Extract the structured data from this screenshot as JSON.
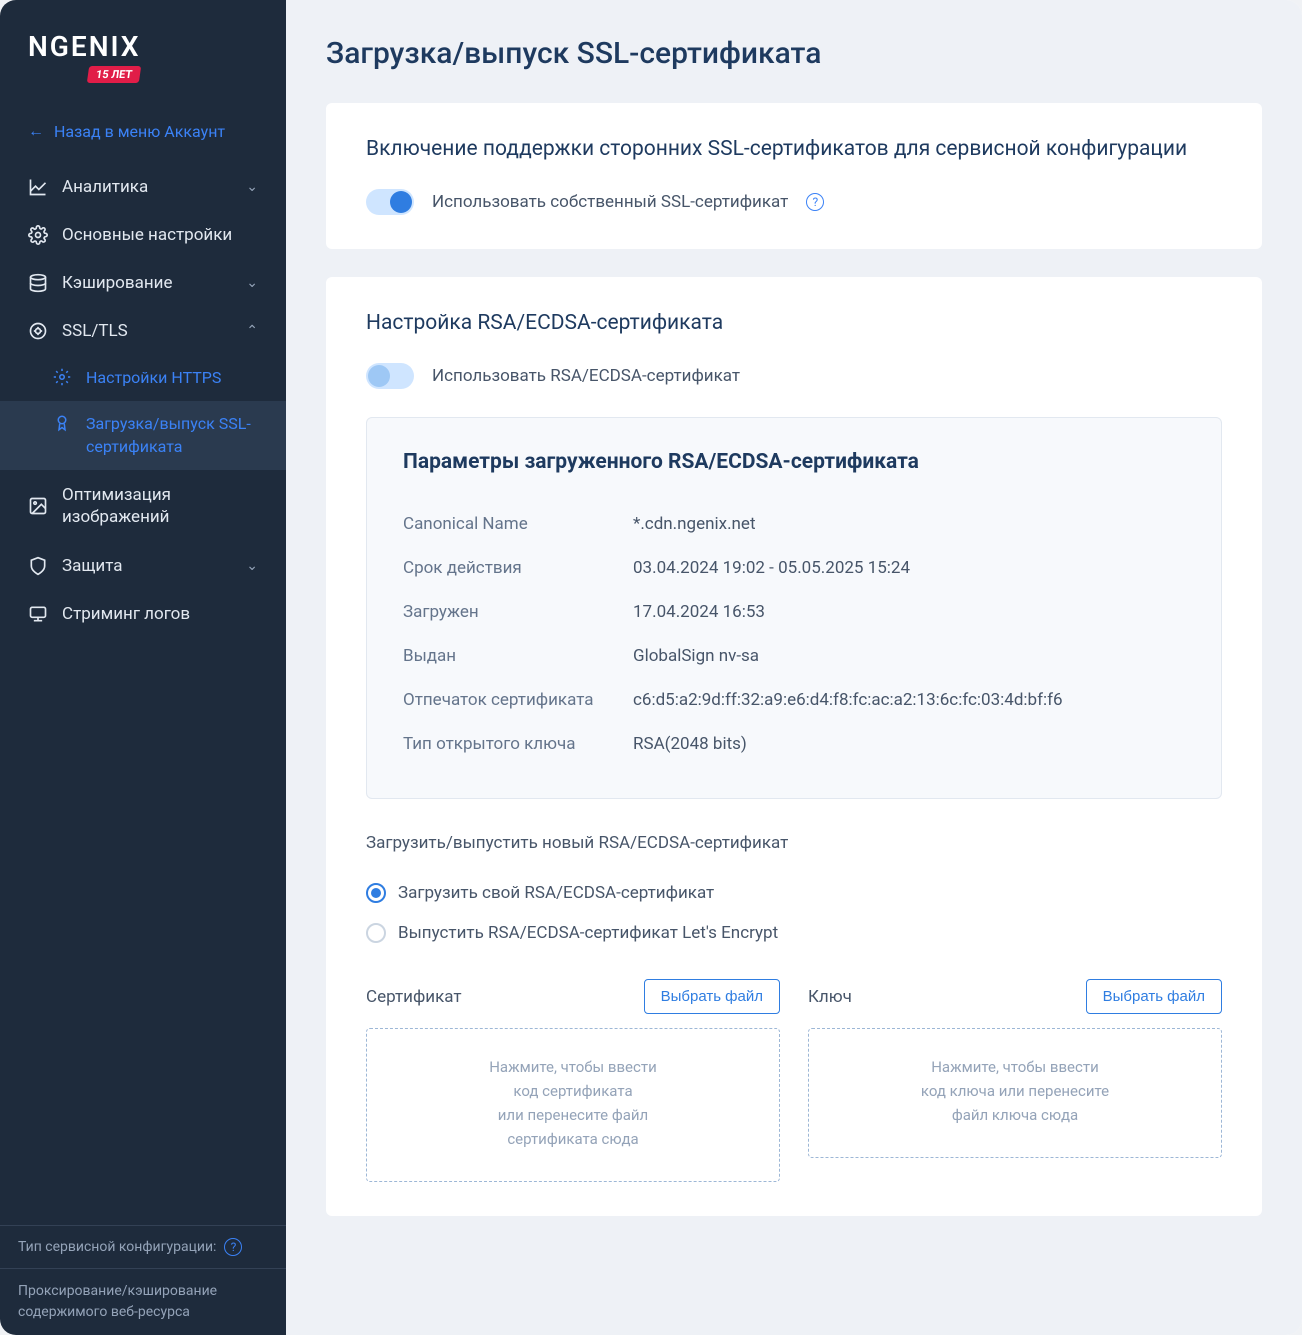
{
  "brand": {
    "name": "NGENIX",
    "badge": "15 ЛЕТ"
  },
  "sidebar": {
    "back": "Назад в меню Аккаунт",
    "items": [
      {
        "label": "Аналитика",
        "expandable": true,
        "open": false
      },
      {
        "label": "Основные настройки",
        "expandable": false
      },
      {
        "label": "Кэширование",
        "expandable": true,
        "open": false
      },
      {
        "label": "SSL/TLS",
        "expandable": true,
        "open": true
      },
      {
        "label": "Оптимизация изображений",
        "expandable": false
      },
      {
        "label": "Защита",
        "expandable": true,
        "open": false
      },
      {
        "label": "Стриминг логов",
        "expandable": false
      }
    ],
    "ssl_sub": [
      {
        "label": "Настройки HTTPS",
        "active": false
      },
      {
        "label": "Загрузка/выпуск SSL-сертификата",
        "active": true
      }
    ],
    "footer": {
      "config_type_label": "Тип сервисной конфигурации:",
      "config_type_value": "Проксирование/кэширование содержимого веб-ресурса"
    }
  },
  "page": {
    "title": "Загрузка/выпуск SSL-сертификата",
    "card1": {
      "title": "Включение поддержки сторонних SSL-сертификатов для сервисной конфигурации",
      "toggle_label": "Использовать собственный SSL-сертификат",
      "toggle_on": true
    },
    "card2": {
      "title": "Настройка RSA/ECDSA-сертификата",
      "toggle_label": "Использовать RSA/ECDSA-сертификат",
      "toggle_on": false,
      "params_title": "Параметры загруженного RSA/ECDSA-сертификата",
      "params": [
        {
          "label": "Canonical Name",
          "value": "*.cdn.ngenix.net"
        },
        {
          "label": "Срок действия",
          "value": "03.04.2024 19:02 - 05.05.2025 15:24"
        },
        {
          "label": "Загружен",
          "value": "17.04.2024 16:53"
        },
        {
          "label": "Выдан",
          "value": "GlobalSign nv-sa"
        },
        {
          "label": "Отпечаток сертификата",
          "value": "c6:d5:a2:9d:ff:32:a9:e6:d4:f8:fc:ac:a2:13:6c:fc:03:4d:bf:f6"
        },
        {
          "label": "Тип открытого ключа",
          "value": "RSA(2048 bits)"
        }
      ],
      "upload_section_label": "Загрузить/выпустить новый RSA/ECDSA-сертификат",
      "radios": [
        {
          "label": "Загрузить свой RSA/ECDSA-сертификат",
          "checked": true
        },
        {
          "label": "Выпустить RSA/ECDSA-сертификат Let's Encrypt",
          "checked": false
        }
      ],
      "cert_col": {
        "title": "Сертификат",
        "button": "Выбрать файл",
        "dropzone": "Нажмите, чтобы ввести\nкод сертификата\nили перенесите файл\nсертификата сюда"
      },
      "key_col": {
        "title": "Ключ",
        "button": "Выбрать файл",
        "dropzone": "Нажмите, чтобы ввести\nкод ключа или перенесите\nфайл ключа сюда"
      }
    }
  }
}
